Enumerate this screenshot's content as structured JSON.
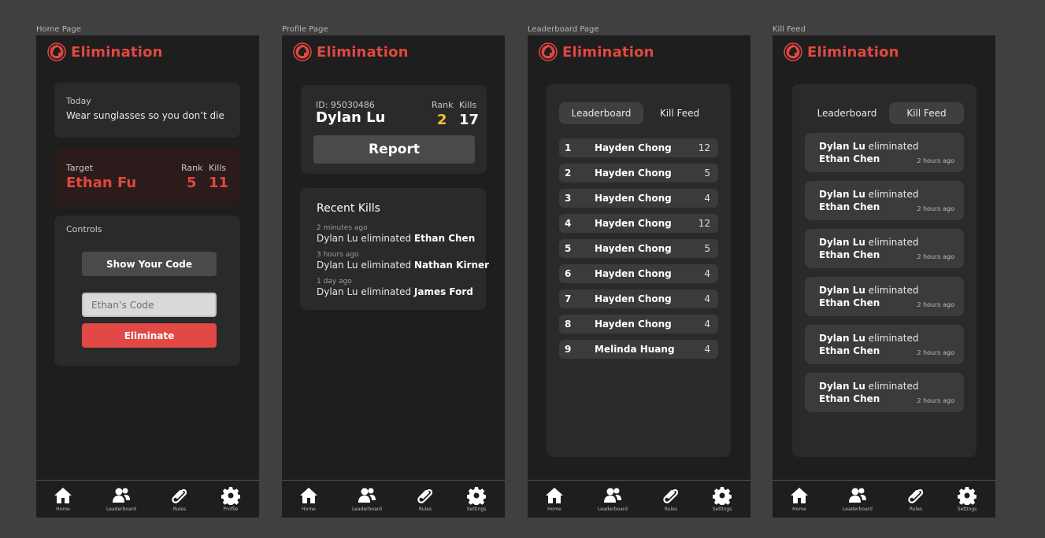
{
  "app": {
    "name": "Elimination"
  },
  "frames": {
    "home": "Home Page",
    "profile": "Profile Page",
    "leaderboard": "Leaderboard Page",
    "killfeed": "Kill Feed"
  },
  "nav_main": [
    "Home",
    "Leaderboard",
    "Rules",
    "Profile"
  ],
  "nav_alt": [
    "Home",
    "Leaderboard",
    "Rules",
    "Settings"
  ],
  "home": {
    "today_label": "Today",
    "today_text": "Wear sunglasses so you don’t die",
    "target_label": "Target",
    "rank_label": "Rank",
    "kills_label": "Kills",
    "target_name": "Ethan Fu",
    "target_rank": "5",
    "target_kills": "11",
    "controls_label": "Controls",
    "show_code_button": "Show Your Code",
    "code_placeholder": "Ethan’s Code",
    "eliminate_button": "Eliminate"
  },
  "profile": {
    "id_text": "ID: 95030486",
    "name": "Dylan Lu",
    "rank_label": "Rank",
    "kills_label": "Kills",
    "rank": "2",
    "kills": "17",
    "report_button": "Report",
    "recent_title": "Recent Kills",
    "recent": [
      {
        "time": "2 minutes ago",
        "prefix": "Dylan Lu eliminated ",
        "victim": "Ethan Chen"
      },
      {
        "time": "3 hours ago",
        "prefix": "Dylan Lu eliminated ",
        "victim": "Nathan Kirner"
      },
      {
        "time": "1 day ago",
        "prefix": "Dylan Lu eliminated ",
        "victim": "James Ford"
      }
    ]
  },
  "tabs": {
    "leaderboard": "Leaderboard",
    "killfeed": "Kill Feed"
  },
  "leaderboard": [
    {
      "rank": "1",
      "name": "Hayden Chong",
      "kills": "12"
    },
    {
      "rank": "2",
      "name": "Hayden Chong",
      "kills": "5"
    },
    {
      "rank": "3",
      "name": "Hayden Chong",
      "kills": "4"
    },
    {
      "rank": "4",
      "name": "Hayden Chong",
      "kills": "12"
    },
    {
      "rank": "5",
      "name": "Hayden Chong",
      "kills": "5"
    },
    {
      "rank": "6",
      "name": "Hayden Chong",
      "kills": "4"
    },
    {
      "rank": "7",
      "name": "Hayden Chong",
      "kills": "4"
    },
    {
      "rank": "8",
      "name": "Hayden Chong",
      "kills": "4"
    },
    {
      "rank": "9",
      "name": "Melinda Huang",
      "kills": "4"
    }
  ],
  "killfeed": [
    {
      "killer": "Dylan Lu",
      "verb": " eliminated",
      "victim": "Ethan Chen",
      "time": "2 hours ago"
    },
    {
      "killer": "Dylan Lu",
      "verb": " eliminated",
      "victim": "Ethan Chen",
      "time": "2 hours ago"
    },
    {
      "killer": "Dylan Lu",
      "verb": " eliminated",
      "victim": "Ethan Chen",
      "time": "2 hours ago"
    },
    {
      "killer": "Dylan Lu",
      "verb": " eliminated",
      "victim": "Ethan Chen",
      "time": "2 hours ago"
    },
    {
      "killer": "Dylan Lu",
      "verb": " eliminated",
      "victim": "Ethan Chen",
      "time": "2 hours ago"
    },
    {
      "killer": "Dylan Lu",
      "verb": " eliminated",
      "victim": "Ethan Chen",
      "time": "2 hours ago"
    }
  ],
  "colors": {
    "accent": "#e2473f",
    "rank_gold": "#f2c230",
    "background": "#404040",
    "panel": "#1e1e1e"
  }
}
